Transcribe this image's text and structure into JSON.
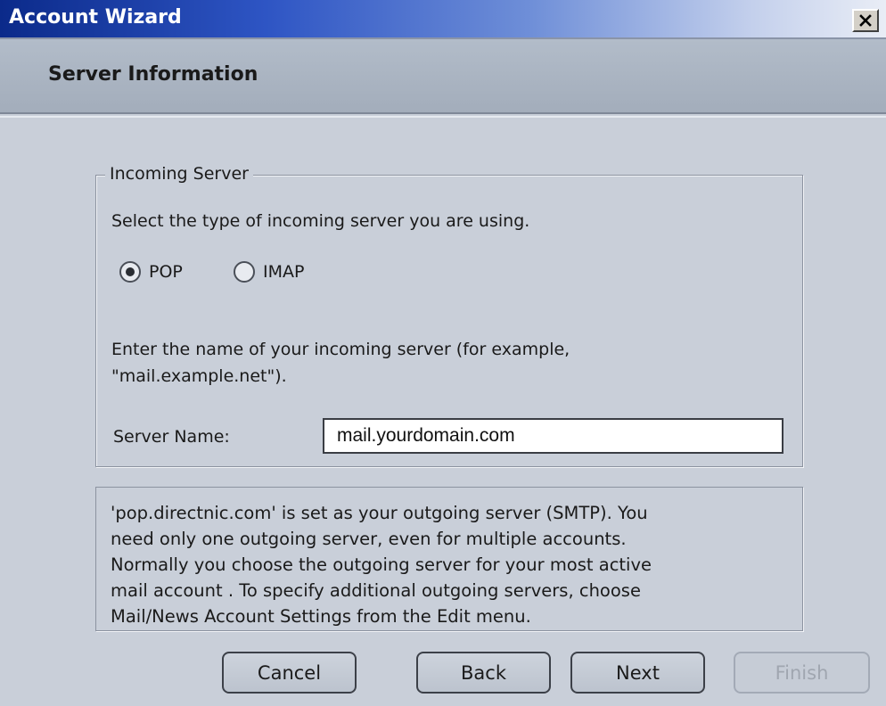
{
  "window": {
    "title": "Account Wizard",
    "close_icon": "close-icon"
  },
  "header": {
    "title": "Server Information"
  },
  "incoming_group": {
    "legend": "Incoming Server",
    "instruction": "Select the type of incoming server you are using.",
    "radio_pop_label": "POP",
    "radio_imap_label": "IMAP",
    "selected": "POP",
    "hint_line1": "Enter the name of your incoming server (for example,",
    "hint_line2": "\"mail.example.net\").",
    "server_name_label": "Server Name:",
    "server_name_value": "mail.yourdomain.com"
  },
  "outgoing_info": {
    "line1": "'pop.directnic.com' is set as your outgoing server (SMTP). You",
    "line2": "need only one outgoing server, even for multiple accounts.",
    "line3": "Normally you choose the outgoing server for your most active",
    "line4": "mail account . To specify additional outgoing servers, choose",
    "line5": "Mail/News Account Settings from the Edit menu."
  },
  "buttons": {
    "cancel": "Cancel",
    "back": "Back",
    "next": "Next",
    "finish": "Finish"
  }
}
